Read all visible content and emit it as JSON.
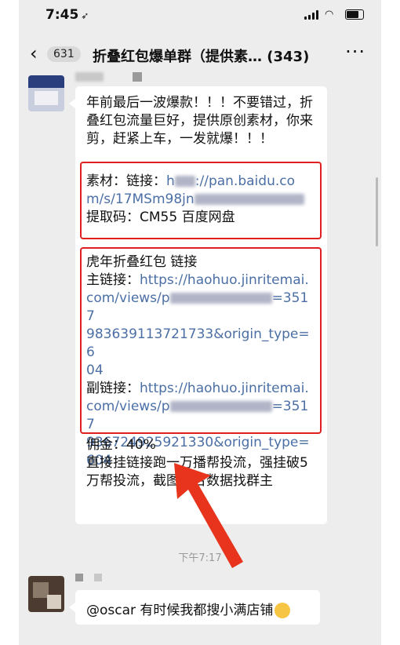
{
  "status_bar": {
    "time": "7:45",
    "location_icon": "location-arrow-icon"
  },
  "nav": {
    "back_icon": "chevron-left-icon",
    "unread_count": "631",
    "title": "折叠红包爆单群（提供素…  (343)",
    "more_icon": "more-dots-icon"
  },
  "message1": {
    "intro": "年前最后一波爆款！！！不要错过，折叠红包流量巨好，提供原创素材，你来剪，赶紧上车，一发就爆！！！",
    "material_label": "素材：链接：",
    "material_link_visible_a": "h",
    "material_link_visible_b": "://pan.baidu.co",
    "material_link_visible_c": "m/s/17MSm98jn",
    "extract_code": "提取码：CM55 百度网盘",
    "section_title": "虎年折叠红包 链接",
    "main_label": "主链接：",
    "main_link_a": "https://haohuo.jinritemai.",
    "main_link_b": "com/views/p",
    "main_link_c": "=3517",
    "main_link_d": "983639113721733&origin_type=6",
    "main_link_e": "04",
    "sub_label": "副链接：",
    "sub_link_a": "https://haohuo.jinritemai.",
    "sub_link_b": "com/views/p",
    "sub_link_c": "=3517",
    "sub_link_d": "936724925921330&origin_type=",
    "sub_link_e": "604",
    "commission": "佣金：40%",
    "note": "直接挂链接跑一万播帮投流，强挂破5万帮投流，截图后台数据找群主"
  },
  "timestamp": "下午7:17",
  "message2": {
    "text": "@oscar 有时候我都搜小满店铺",
    "emoji_icon": "sweat-smile-emoji-icon"
  },
  "colors": {
    "highlight_box": "#e02020",
    "arrow": "#e8341c",
    "link": "#4b6fa5"
  }
}
